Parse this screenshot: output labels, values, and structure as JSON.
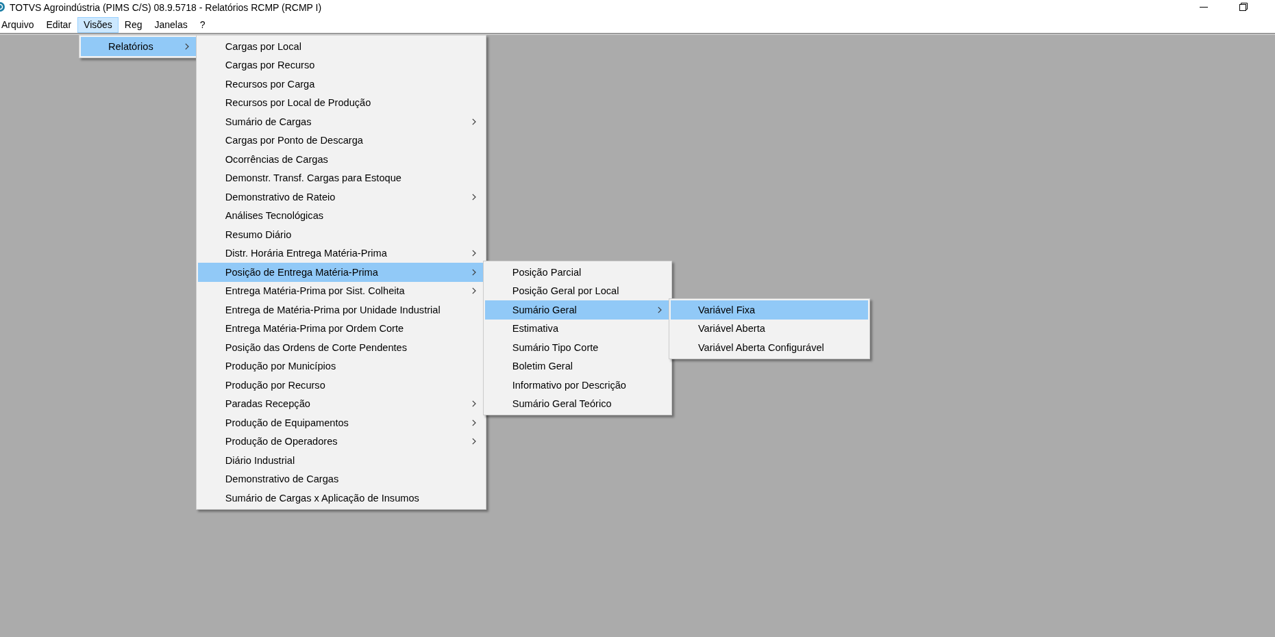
{
  "window": {
    "title": "TOTVS Agroindústria (PIMS C/S) 08.9.5718 - Relatórios RCMP (RCMP I)"
  },
  "menu_bar": [
    {
      "label": "Arquivo",
      "selected": false
    },
    {
      "label": "Editar",
      "selected": false
    },
    {
      "label": "Visões",
      "selected": true,
      "menu": [
        {
          "label": "Relatórios",
          "selected": true,
          "has_submenu": true,
          "menu": [
            {
              "label": "Cargas por Local",
              "selected": false,
              "has_submenu": false
            },
            {
              "label": "Cargas por Recurso",
              "selected": false,
              "has_submenu": false
            },
            {
              "label": "Recursos por Carga",
              "selected": false,
              "has_submenu": false
            },
            {
              "label": "Recursos por Local de Produção",
              "selected": false,
              "has_submenu": false
            },
            {
              "label": "Sumário de Cargas",
              "selected": false,
              "has_submenu": true
            },
            {
              "label": "Cargas por Ponto de Descarga",
              "selected": false,
              "has_submenu": false
            },
            {
              "label": "Ocorrências de Cargas",
              "selected": false,
              "has_submenu": false
            },
            {
              "label": "Demonstr. Transf. Cargas para Estoque",
              "selected": false,
              "has_submenu": false
            },
            {
              "label": "Demonstrativo de Rateio",
              "selected": false,
              "has_submenu": true
            },
            {
              "label": "Análises Tecnológicas",
              "selected": false,
              "has_submenu": false
            },
            {
              "label": "Resumo Diário",
              "selected": false,
              "has_submenu": false
            },
            {
              "label": "Distr. Horária Entrega Matéria-Prima",
              "selected": false,
              "has_submenu": true
            },
            {
              "label": "Posição de Entrega Matéria-Prima",
              "selected": true,
              "has_submenu": true,
              "menu": [
                {
                  "label": "Posição Parcial",
                  "selected": false,
                  "has_submenu": false
                },
                {
                  "label": "Posição Geral por Local",
                  "selected": false,
                  "has_submenu": false
                },
                {
                  "label": "Sumário Geral",
                  "selected": true,
                  "has_submenu": true,
                  "menu": [
                    {
                      "label": "Variável Fixa",
                      "selected": true,
                      "has_submenu": false
                    },
                    {
                      "label": "Variável Aberta",
                      "selected": false,
                      "has_submenu": false
                    },
                    {
                      "label": "Variável Aberta Configurável",
                      "selected": false,
                      "has_submenu": false
                    }
                  ]
                },
                {
                  "label": "Estimativa",
                  "selected": false,
                  "has_submenu": false
                },
                {
                  "label": "Sumário Tipo Corte",
                  "selected": false,
                  "has_submenu": false
                },
                {
                  "label": "Boletim Geral",
                  "selected": false,
                  "has_submenu": false
                },
                {
                  "label": "Informativo por Descrição",
                  "selected": false,
                  "has_submenu": false
                },
                {
                  "label": "Sumário Geral Teórico",
                  "selected": false,
                  "has_submenu": false
                }
              ]
            },
            {
              "label": "Entrega Matéria-Prima por Sist. Colheita",
              "selected": false,
              "has_submenu": true
            },
            {
              "label": "Entrega de Matéria-Prima por Unidade Industrial",
              "selected": false,
              "has_submenu": false
            },
            {
              "label": "Entrega Matéria-Prima por Ordem Corte",
              "selected": false,
              "has_submenu": false
            },
            {
              "label": "Posição das Ordens de Corte Pendentes",
              "selected": false,
              "has_submenu": false
            },
            {
              "label": "Produção por Municípios",
              "selected": false,
              "has_submenu": false
            },
            {
              "label": "Produção por Recurso",
              "selected": false,
              "has_submenu": false
            },
            {
              "label": "Paradas Recepção",
              "selected": false,
              "has_submenu": true
            },
            {
              "label": "Produção de Equipamentos",
              "selected": false,
              "has_submenu": true
            },
            {
              "label": "Produção de Operadores",
              "selected": false,
              "has_submenu": true
            },
            {
              "label": "Diário Industrial",
              "selected": false,
              "has_submenu": false
            },
            {
              "label": "Demonstrativo de Cargas",
              "selected": false,
              "has_submenu": false
            },
            {
              "label": "Sumário de Cargas x Aplicação de Insumos",
              "selected": false,
              "has_submenu": false
            }
          ]
        }
      ]
    },
    {
      "label": "Reg",
      "selected": false
    },
    {
      "label": "Janelas",
      "selected": false
    },
    {
      "label": "?",
      "selected": false
    }
  ]
}
